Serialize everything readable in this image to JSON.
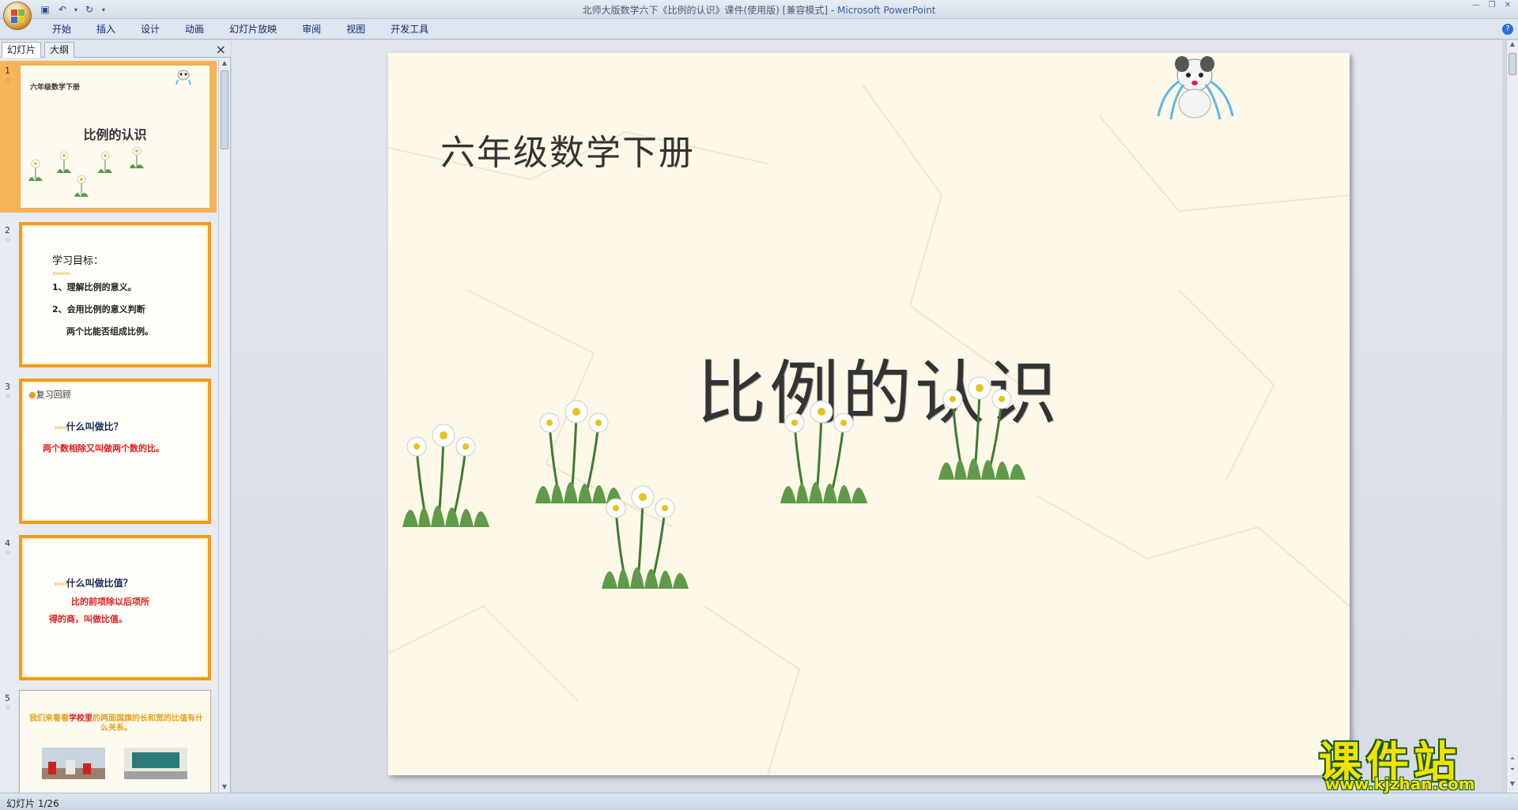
{
  "window": {
    "title": "北师大版数学六下《比例的认识》课件(使用版) [兼容模式]",
    "separator": " - ",
    "app_name": "Microsoft PowerPoint"
  },
  "ribbon": {
    "tabs": [
      "开始",
      "插入",
      "设计",
      "动画",
      "幻灯片放映",
      "审阅",
      "视图",
      "开发工具"
    ],
    "help": "?"
  },
  "left_pane": {
    "tab_slides": "幻灯片",
    "tab_outline": "大纲",
    "close": "×",
    "thumbnails": [
      {
        "num": "1",
        "subtitle": "六年级数学下册",
        "title": "比例的认识"
      },
      {
        "num": "2",
        "heading": "学习目标：",
        "lines": [
          "1、理解比例的意义。",
          "2、会用比例的意义判断",
          "两个比能否组成比例。"
        ]
      },
      {
        "num": "3",
        "label": "复习回顾",
        "question": "什么叫做比？",
        "answer": "两个数相除又叫做两个数的比。"
      },
      {
        "num": "4",
        "question": "什么叫做比值？",
        "answer_lines": [
          "比的前项除以后项所",
          "得的商，叫做比值。"
        ]
      },
      {
        "num": "5",
        "text_a": "我们来看看",
        "text_b": "学校里",
        "text_c": "的两面国旗的长和宽的比值有什么关系。"
      }
    ]
  },
  "slide": {
    "subtitle": "六年级数学下册",
    "title": "比例的认识"
  },
  "status": {
    "slide_indicator": "幻灯片 1/26"
  },
  "watermark": {
    "logo": "课件站",
    "url": "www.kjzhan.com"
  },
  "colors": {
    "slide_bg": "#fef8e8",
    "thumb_border_orange": "#f29a1e",
    "selected": "#f6b357",
    "red_text": "#e21b1b",
    "watermark_yellow": "#f2e200"
  }
}
